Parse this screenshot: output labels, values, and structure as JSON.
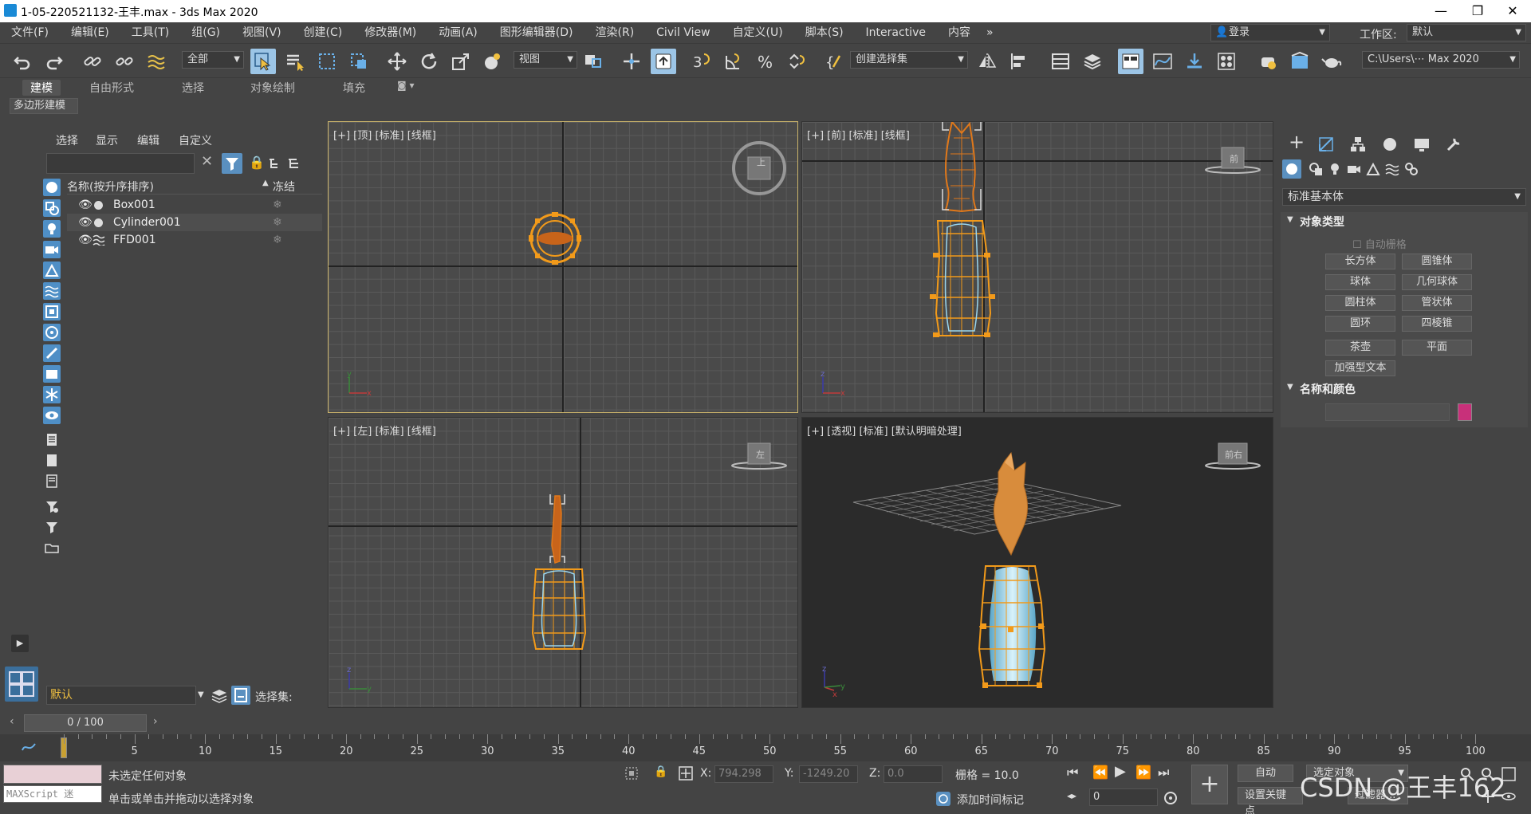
{
  "window": {
    "title": "1-05-220521132-王丰.max - 3ds Max 2020",
    "minimize": "—",
    "maximize": "❐",
    "close": "✕"
  },
  "menu": {
    "items": [
      "文件(F)",
      "编辑(E)",
      "工具(T)",
      "组(G)",
      "视图(V)",
      "创建(C)",
      "修改器(M)",
      "动画(A)",
      "图形编辑器(D)",
      "渲染(R)",
      "Civil View",
      "自定义(U)",
      "脚本(S)",
      "Interactive",
      "内容"
    ],
    "overflow": "»",
    "login_label": "登录",
    "workspace_label": "工作区:",
    "workspace_value": "默认"
  },
  "toolbar": {
    "selection_filter": "全部",
    "ref_coord": "视图",
    "named_selection": "创建选择集",
    "path": "C:\\Users\\⋯ Max 2020"
  },
  "ribbon": {
    "tabs": [
      "建模",
      "自由形式",
      "选择",
      "对象绘制",
      "填充"
    ],
    "panel_label": "多边形建模"
  },
  "explorer": {
    "menus": [
      "选择",
      "显示",
      "编辑",
      "自定义"
    ],
    "col_name": "名称(按升序排序)",
    "col_freeze": "冻结",
    "rows": [
      {
        "name": "Box001"
      },
      {
        "name": "Cylinder001"
      },
      {
        "name": "FFD001"
      }
    ],
    "layer_value": "默认",
    "selection_set_label": "选择集:"
  },
  "viewports": {
    "top": "[+] [顶] [标准] [线框]",
    "front": "[+] [前] [标准] [线框]",
    "left": "[+] [左] [标准] [线框]",
    "persp": "[+] [透视] [标准] [默认明暗处理]",
    "cube_top": "上",
    "cube_front": "前",
    "cube_left": "左",
    "cube_persp": "前右"
  },
  "command_panel": {
    "category": "标准基本体",
    "rollout_object_type": "对象类型",
    "autogrid": "自动栅格",
    "buttons": [
      "长方体",
      "圆锥体",
      "球体",
      "几何球体",
      "圆柱体",
      "管状体",
      "圆环",
      "四棱锥",
      "茶壶",
      "平面",
      "加强型文本"
    ],
    "rollout_name_color": "名称和颜色",
    "object_color": "#c8307a"
  },
  "timeline": {
    "frame_display": "0 / 100",
    "ticks": [
      "5",
      "10",
      "15",
      "20",
      "25",
      "30",
      "35",
      "40",
      "45",
      "50",
      "55",
      "60",
      "65",
      "70",
      "75",
      "80",
      "85",
      "90",
      "95",
      "100"
    ],
    "current_frame": 0
  },
  "status": {
    "maxscript_label": "MAXScript 迷",
    "line1": "未选定任何对象",
    "line2": "单击或单击并拖动以选择对象",
    "x_label": "X:",
    "x_value": "794.298",
    "y_label": "Y:",
    "y_value": "-1249.20",
    "z_label": "Z:",
    "z_value": "0.0",
    "grid_label": "栅格 = 10.0",
    "add_time_tag": "添加时间标记",
    "auto_key": "自动",
    "set_key": "设置关键点",
    "selected_object": "选定对象",
    "filter": "过滤器...",
    "frame_input": "0",
    "watermark": "CSDN @王丰162"
  }
}
